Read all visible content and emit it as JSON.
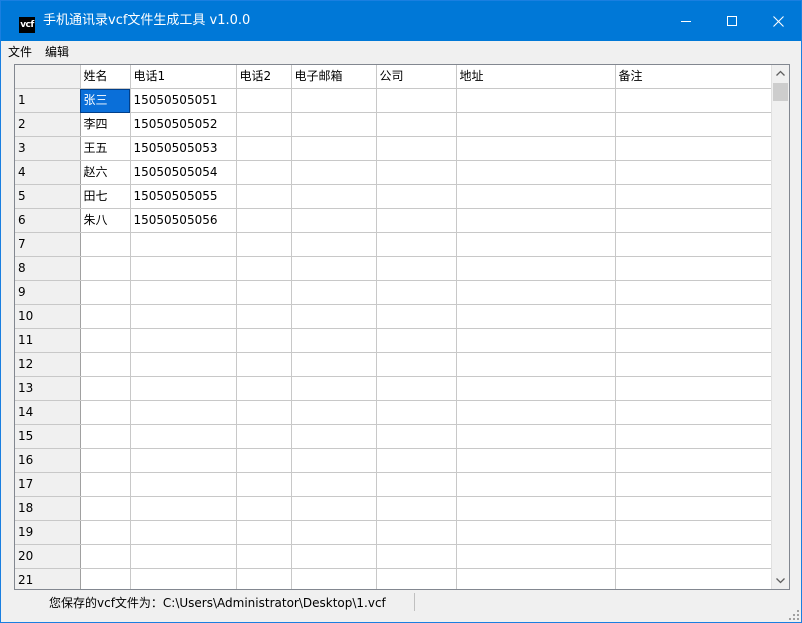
{
  "window": {
    "title": "手机通讯录vcf文件生成工具 v1.0.0",
    "icon_text": "vcf",
    "accent_color": "#0078d7"
  },
  "menu": {
    "items": [
      "文件",
      "编辑"
    ]
  },
  "grid": {
    "columns": [
      "姓名",
      "电话1",
      "电话2",
      "电子邮箱",
      "公司",
      "地址",
      "备注"
    ],
    "rows": [
      {
        "num": "1",
        "cells": [
          "张三",
          "15050505051",
          "",
          "",
          "",
          "",
          ""
        ]
      },
      {
        "num": "2",
        "cells": [
          "李四",
          "15050505052",
          "",
          "",
          "",
          "",
          ""
        ]
      },
      {
        "num": "3",
        "cells": [
          "王五",
          "15050505053",
          "",
          "",
          "",
          "",
          ""
        ]
      },
      {
        "num": "4",
        "cells": [
          "赵六",
          "15050505054",
          "",
          "",
          "",
          "",
          ""
        ]
      },
      {
        "num": "5",
        "cells": [
          "田七",
          "15050505055",
          "",
          "",
          "",
          "",
          ""
        ]
      },
      {
        "num": "6",
        "cells": [
          "朱八",
          "15050505056",
          "",
          "",
          "",
          "",
          ""
        ]
      },
      {
        "num": "7",
        "cells": [
          "",
          "",
          "",
          "",
          "",
          "",
          ""
        ]
      },
      {
        "num": "8",
        "cells": [
          "",
          "",
          "",
          "",
          "",
          "",
          ""
        ]
      },
      {
        "num": "9",
        "cells": [
          "",
          "",
          "",
          "",
          "",
          "",
          ""
        ]
      },
      {
        "num": "10",
        "cells": [
          "",
          "",
          "",
          "",
          "",
          "",
          ""
        ]
      },
      {
        "num": "11",
        "cells": [
          "",
          "",
          "",
          "",
          "",
          "",
          ""
        ]
      },
      {
        "num": "12",
        "cells": [
          "",
          "",
          "",
          "",
          "",
          "",
          ""
        ]
      },
      {
        "num": "13",
        "cells": [
          "",
          "",
          "",
          "",
          "",
          "",
          ""
        ]
      },
      {
        "num": "14",
        "cells": [
          "",
          "",
          "",
          "",
          "",
          "",
          ""
        ]
      },
      {
        "num": "15",
        "cells": [
          "",
          "",
          "",
          "",
          "",
          "",
          ""
        ]
      },
      {
        "num": "16",
        "cells": [
          "",
          "",
          "",
          "",
          "",
          "",
          ""
        ]
      },
      {
        "num": "17",
        "cells": [
          "",
          "",
          "",
          "",
          "",
          "",
          ""
        ]
      },
      {
        "num": "18",
        "cells": [
          "",
          "",
          "",
          "",
          "",
          "",
          ""
        ]
      },
      {
        "num": "19",
        "cells": [
          "",
          "",
          "",
          "",
          "",
          "",
          ""
        ]
      },
      {
        "num": "20",
        "cells": [
          "",
          "",
          "",
          "",
          "",
          "",
          ""
        ]
      },
      {
        "num": "21",
        "cells": [
          "",
          "",
          "",
          "",
          "",
          "",
          ""
        ]
      }
    ],
    "selected_cell_color": "#0a6fd9"
  },
  "status": {
    "text": "您保存的vcf文件为：C:\\Users\\Administrator\\Desktop\\1.vcf"
  },
  "icons": {
    "minimize": "minimize-icon",
    "maximize": "maximize-icon",
    "close": "close-icon",
    "scroll_up": "chevron-up-icon",
    "scroll_down": "chevron-down-icon",
    "resize": "resize-grip-icon"
  }
}
